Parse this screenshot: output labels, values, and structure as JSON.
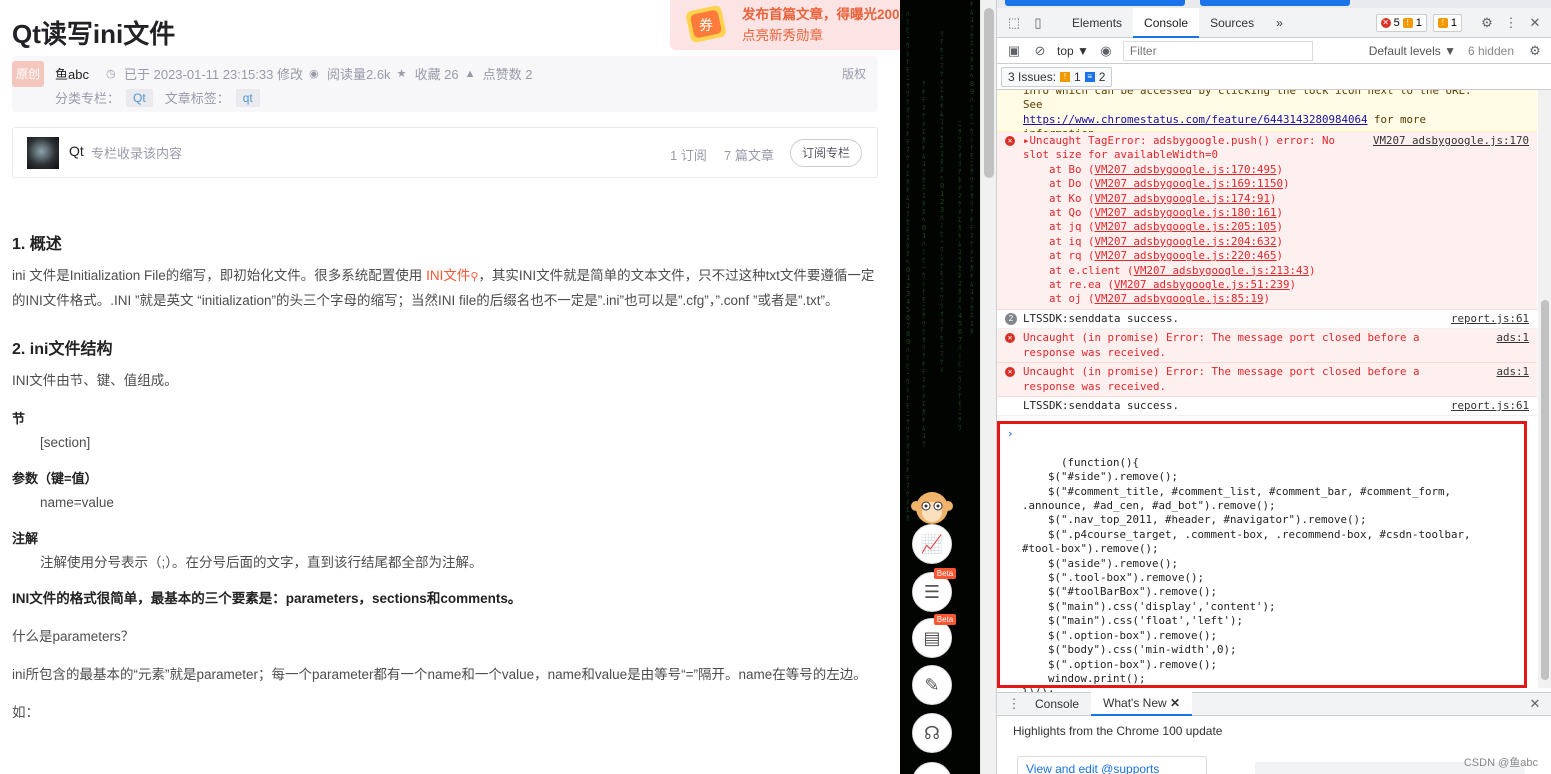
{
  "article": {
    "title": "Qt读写ini文件",
    "promo": {
      "coupon_text": "券",
      "line1": "发布首篇文章，得曝光2000流量券",
      "line2": "点亮新秀勋章"
    },
    "meta": {
      "badge": "原创",
      "author": "鱼abc",
      "date": "已于 2023-01-11 23:15:33 修改",
      "views": "阅读量2.6k",
      "favorites": "收藏 26",
      "likes": "点赞数 2",
      "copyright": "版权",
      "column_label": "分类专栏：",
      "column_tag": "Qt",
      "tag_label": "文章标签：",
      "article_tag": "qt"
    },
    "column_card": {
      "name": "Qt",
      "desc": "专栏收录该内容",
      "subs": "1 订阅",
      "posts": "7 篇文章",
      "subscribe": "订阅专栏"
    },
    "s1": {
      "heading": "1. 概述",
      "p1_a": "ini 文件是Initialization File的缩写，即初始化文件。很多系统配置使用 ",
      "p1_link": "INI文件",
      "p1_b": "，其实INI文件就是简单的文本文件，只不过这种txt文件要遵循一定的INI文件格式。.INI ”就是英文 “initialization”的头三个字母的缩写；当然INI file的后缀名也不一定是”.ini”也可以是”.cfg”，”.conf ”或者是”.txt”。"
    },
    "s2": {
      "heading": "2. ini文件结构",
      "intro": "INI文件由节、键、值组成。",
      "sec_title": "节",
      "sec_body": "[section]",
      "param_title": "参数（键=值）",
      "param_body": "name=value",
      "note_title": "注解",
      "note_body": "注解使用分号表示（;）。在分号后面的文字，直到该行结尾都全部为注解。",
      "bold_line": "INI文件的格式很简单，最基本的三个要素是：parameters，sections和comments。",
      "q": "什么是parameters？",
      "p_param": "ini所包含的最基本的“元素”就是parameter；每一个parameter都有一个name和一个value，name和value是由等号“=”隔开。name在等号的左边。",
      "example": "如："
    }
  },
  "sidebar": {
    "beta": "Beta"
  },
  "devtools": {
    "tabs": [
      "Elements",
      "Console",
      "Sources"
    ],
    "more_tabs": "»",
    "errors": "5",
    "warnings": "1",
    "infos": "1",
    "context": "top ▼",
    "filter_placeholder": "Filter",
    "levels": "Default levels ▼",
    "hidden": "6 hidden",
    "issues_label": "3 Issues:",
    "issues_warn": "1",
    "issues_info": "2",
    "messages": {
      "warn_top": "info which can be accessed by clicking the lock icon next to the URL. See",
      "warn_link": "https://www.chromestatus.com/feature/6443143280984064",
      "warn_tail": " for more",
      "warn_last": "information.",
      "err1_head": "Uncaught TagError: adsbygoogle.push() error: No ",
      "err1_src": "VM207 adsbygoogle.js:170",
      "err1_cont": "slot size for availableWidth=0",
      "stack": [
        {
          "fn": "at Bo",
          "loc": "VM207 adsbygoogle.js:170:495"
        },
        {
          "fn": "at Do",
          "loc": "VM207 adsbygoogle.js:169:1150"
        },
        {
          "fn": "at Ko",
          "loc": "VM207 adsbygoogle.js:174:91"
        },
        {
          "fn": "at Qo",
          "loc": "VM207 adsbygoogle.js:180:161"
        },
        {
          "fn": "at jq",
          "loc": "VM207 adsbygoogle.js:205:105"
        },
        {
          "fn": "at iq",
          "loc": "VM207 adsbygoogle.js:204:632"
        },
        {
          "fn": "at rq",
          "loc": "VM207 adsbygoogle.js:220:465"
        },
        {
          "fn": "at e.client",
          "loc": "VM207 adsbygoogle.js:213:43"
        },
        {
          "fn": "at re.ea",
          "loc": "VM207 adsbygoogle.js:51:239"
        },
        {
          "fn": "at oj",
          "loc": "VM207 adsbygoogle.js:85:19"
        }
      ],
      "log1_count": "2",
      "log1": "LTSSDK:senddata success.",
      "log1_src": "report.js:61",
      "err2": "Uncaught (in promise) Error: The message port closed before a",
      "err2_cont": "response was received.",
      "err2_src": "ads:1",
      "err3": "Uncaught (in promise) Error: The message port closed before a",
      "err3_cont": "response was received.",
      "err3_src": "ads:1",
      "log2": "LTSSDK:senddata success.",
      "log2_src": "report.js:61"
    },
    "code": "(function(){\n    $(\"#side\").remove();\n    $(\"#comment_title, #comment_list, #comment_bar, #comment_form,\n.announce, #ad_cen, #ad_bot\").remove();\n    $(\".nav_top_2011, #header, #navigator\").remove();\n    $(\".p4course_target, .comment-box, .recommend-box, #csdn-toolbar,\n#tool-box\").remove();\n    $(\"aside\").remove();\n    $(\".tool-box\").remove();\n    $(\"#toolBarBox\").remove();\n    $(\"main\").css('display','content');\n    $(\"main\").css('float','left');\n    $(\".option-box\").remove();\n    $(\"body\").css('min-width',0);\n    $(\".option-box\").remove();\n    window.print();\n})();",
    "drawer_tabs": [
      "Console",
      "What's New"
    ],
    "whatsnew_headline": "Highlights from the Chrome 100 update",
    "whatsnew_card": "View and edit @supports",
    "watermark": "CSDN @鱼abc"
  }
}
